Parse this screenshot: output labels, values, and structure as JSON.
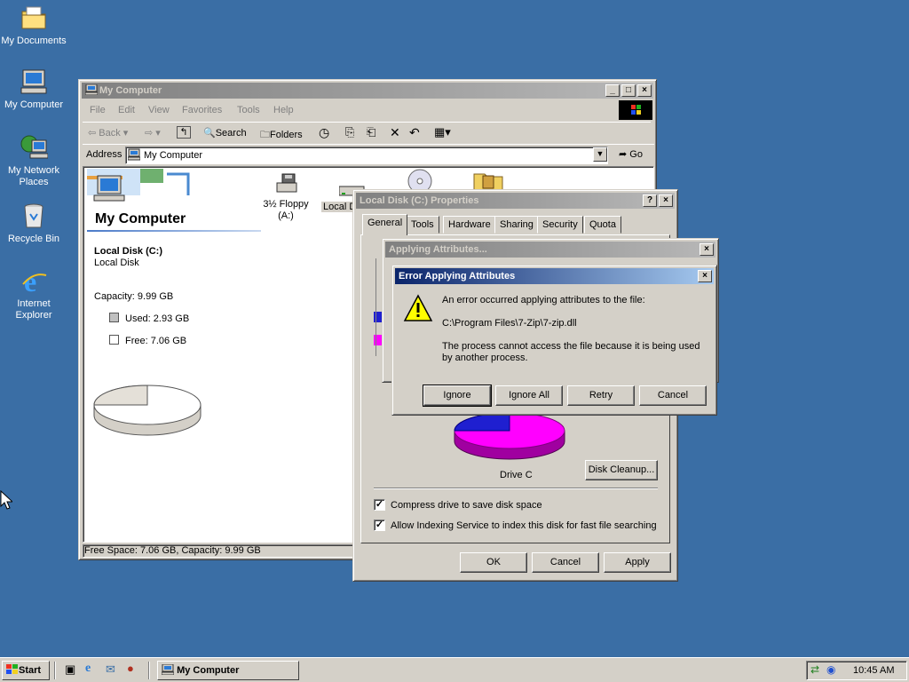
{
  "desktop": {
    "icons": [
      {
        "label": "My Documents"
      },
      {
        "label": "My Computer"
      },
      {
        "label": "My Network Places"
      },
      {
        "label": "Recycle Bin"
      },
      {
        "label": "Internet Explorer"
      }
    ]
  },
  "explorer": {
    "title": "My Computer",
    "menu": [
      "File",
      "Edit",
      "View",
      "Favorites",
      "Tools",
      "Help"
    ],
    "toolbar": {
      "back": "Back",
      "search": "Search",
      "folders": "Folders"
    },
    "address_label": "Address",
    "address_value": "My Computer",
    "go_label": "Go",
    "panel_title": "My Computer",
    "drive_name": "Local Disk (C:)",
    "drive_type": "Local Disk",
    "capacity": "Capacity: 9.99 GB",
    "used": "Used: 2.93 GB",
    "free": "Free: 7.06 GB",
    "items": [
      {
        "label": "3½ Floppy (A:)"
      },
      {
        "label": "Local D"
      }
    ],
    "status": "Free Space: 7.06 GB, Capacity: 9.99 GB",
    "used_fraction": 0.293
  },
  "properties": {
    "title": "Local Disk (C:) Properties",
    "tabs": [
      "General",
      "Tools",
      "Hardware",
      "Sharing",
      "Security",
      "Quota"
    ],
    "drive_label": "Drive C",
    "disk_cleanup": "Disk Cleanup...",
    "compress": "Compress drive to save disk space",
    "indexing": "Allow Indexing Service to index this disk for fast file searching",
    "ok": "OK",
    "cancel": "Cancel",
    "apply": "Apply"
  },
  "applying": {
    "title": "Applying Attributes..."
  },
  "error": {
    "title": "Error Applying Attributes",
    "line1": "An error occurred applying attributes to the file:",
    "path": "C:\\Program Files\\7-Zip\\7-zip.dll",
    "line2": "The process cannot access the file because it is being used by another process.",
    "buttons": {
      "ignore": "Ignore",
      "ignore_all": "Ignore All",
      "retry": "Retry",
      "cancel": "Cancel"
    }
  },
  "taskbar": {
    "start": "Start",
    "task": "My Computer",
    "clock": "10:45 AM"
  },
  "colors": {
    "desktop": "#3a6ea5",
    "used_slice": "#1f1fd0",
    "free_slice": "#ff00ff"
  }
}
